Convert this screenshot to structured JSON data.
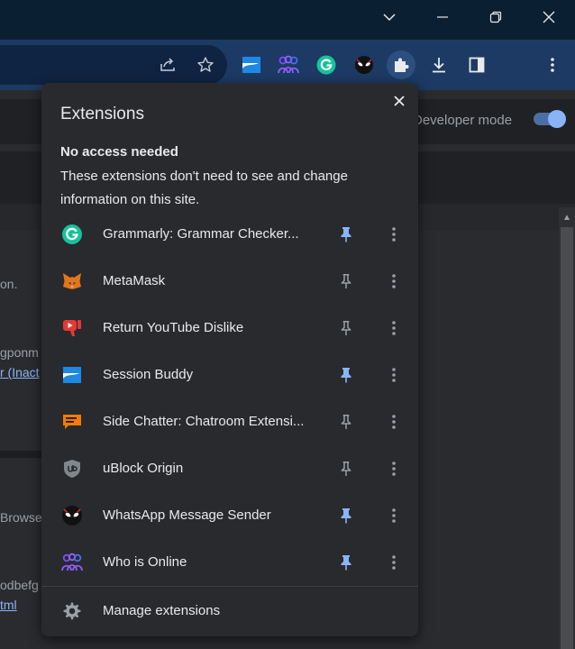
{
  "popup": {
    "title": "Extensions",
    "section_heading": "No access needed",
    "section_description": "These extensions don't need to see and change information on this site.",
    "manage_label": "Manage extensions"
  },
  "extensions": [
    {
      "name": "Grammarly: Grammar Checker...",
      "icon": "grammarly-icon",
      "pinned": true
    },
    {
      "name": "MetaMask",
      "icon": "metamask-fox-icon",
      "pinned": false
    },
    {
      "name": "Return YouTube Dislike",
      "icon": "youtube-dislike-icon",
      "pinned": false
    },
    {
      "name": "Session Buddy",
      "icon": "session-buddy-icon",
      "pinned": true
    },
    {
      "name": "Side Chatter: Chatroom Extensi...",
      "icon": "chat-bubble-icon",
      "pinned": false
    },
    {
      "name": "uBlock Origin",
      "icon": "ublock-shield-icon",
      "pinned": false
    },
    {
      "name": "WhatsApp Message Sender",
      "icon": "spiderman-mask-icon",
      "pinned": true
    },
    {
      "name": "Who is Online",
      "icon": "people-group-icon",
      "pinned": true
    }
  ],
  "background": {
    "developer_mode_label": "Developer mode",
    "fragment_1": "on.",
    "fragment_2": "gponm",
    "fragment_3": "r (Inact",
    "fragment_4": "Browse",
    "fragment_5": "odbefg",
    "fragment_6": "tml"
  },
  "colors": {
    "popup_bg": "#292a2d",
    "text": "#e8eaed",
    "pin_active": "#8ab4f8",
    "pin_inactive": "#9aa0a6",
    "toolbar_bg": "#1c3a63",
    "titlebar_bg": "#0b1f33"
  }
}
